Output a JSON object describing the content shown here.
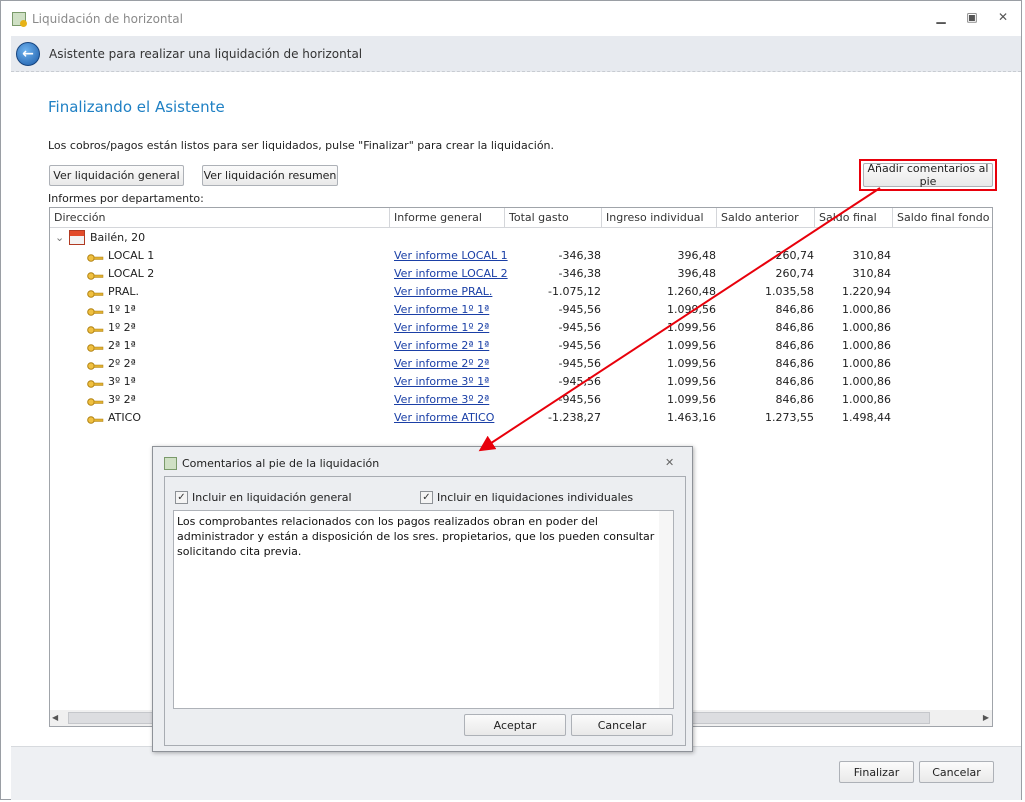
{
  "window": {
    "title": "Liquidación de horizontal",
    "minimize": "▁",
    "maximize": "▣",
    "close": "✕"
  },
  "header": {
    "title": "Asistente para realizar una liquidación de horizontal"
  },
  "page": {
    "title": "Finalizando el Asistente",
    "description": "Los cobros/pagos están listos para ser liquidados, pulse \"Finalizar\" para crear la liquidación.",
    "btn_general": "Ver liquidación general",
    "btn_resumen": "Ver liquidación resumen",
    "btn_comentarios": "Añadir comentarios al pie",
    "informes_label": "Informes por departamento:"
  },
  "grid": {
    "columns": [
      "Dirección",
      "Informe general",
      "Total gasto",
      "Ingreso individual",
      "Saldo anterior",
      "Saldo final",
      "Saldo final fondo res"
    ],
    "group": "Bailén, 20",
    "rows": [
      {
        "dir": "LOCAL 1",
        "link": "Ver informe LOCAL 1",
        "gasto": "-346,38",
        "ingreso": "396,48",
        "anterior": "260,74",
        "final": "310,84"
      },
      {
        "dir": "LOCAL 2",
        "link": "Ver informe LOCAL 2",
        "gasto": "-346,38",
        "ingreso": "396,48",
        "anterior": "260,74",
        "final": "310,84"
      },
      {
        "dir": "PRAL.",
        "link": "Ver informe PRAL.",
        "gasto": "-1.075,12",
        "ingreso": "1.260,48",
        "anterior": "1.035,58",
        "final": "1.220,94"
      },
      {
        "dir": "1º 1ª",
        "link": "Ver informe 1º 1ª",
        "gasto": "-945,56",
        "ingreso": "1.099,56",
        "anterior": "846,86",
        "final": "1.000,86"
      },
      {
        "dir": "1º 2ª",
        "link": "Ver informe 1º 2ª",
        "gasto": "-945,56",
        "ingreso": "1.099,56",
        "anterior": "846,86",
        "final": "1.000,86"
      },
      {
        "dir": "2ª 1ª",
        "link": "Ver informe 2ª 1ª",
        "gasto": "-945,56",
        "ingreso": "1.099,56",
        "anterior": "846,86",
        "final": "1.000,86"
      },
      {
        "dir": "2º 2ª",
        "link": "Ver informe 2º 2ª",
        "gasto": "-945,56",
        "ingreso": "1.099,56",
        "anterior": "846,86",
        "final": "1.000,86"
      },
      {
        "dir": "3º 1ª",
        "link": "Ver informe 3º 1ª",
        "gasto": "-945,56",
        "ingreso": "1.099,56",
        "anterior": "846,86",
        "final": "1.000,86"
      },
      {
        "dir": "3º 2ª",
        "link": "Ver informe 3º 2ª",
        "gasto": "-945,56",
        "ingreso": "1.099,56",
        "anterior": "846,86",
        "final": "1.000,86"
      },
      {
        "dir": "ATICO",
        "link": "Ver informe ATICO",
        "gasto": "-1.238,27",
        "ingreso": "1.463,16",
        "anterior": "1.273,55",
        "final": "1.498,44"
      }
    ]
  },
  "dialog": {
    "title": "Comentarios al pie de la liquidación",
    "close": "✕",
    "chk_general": "Incluir en liquidación general",
    "chk_individual": "Incluir en liquidaciones individuales",
    "comment": "Los comprobantes relacionados con los pagos realizados obran en poder del administrador y están a disposición de los sres. propietarios, que los pueden consultar solicitando cita previa.",
    "aceptar": "Aceptar",
    "cancelar": "Cancelar"
  },
  "footer": {
    "finalizar": "Finalizar",
    "cancelar": "Cancelar"
  },
  "colors": {
    "accent": "#1f80c4",
    "link": "#1a3fa6",
    "annotation": "#e8000b"
  }
}
